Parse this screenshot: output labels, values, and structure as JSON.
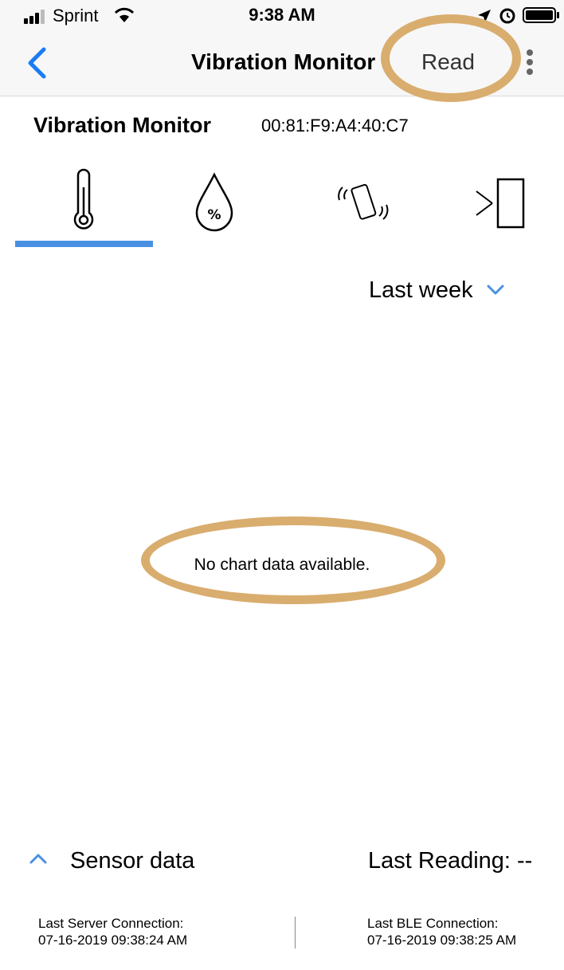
{
  "status_bar": {
    "carrier": "Sprint",
    "time": "9:38 AM"
  },
  "nav": {
    "title": "Vibration Monitor",
    "action_label": "Read",
    "accent_color": "#1a7cf5"
  },
  "device": {
    "name": "Vibration Monitor",
    "mac": "00:81:F9:A4:40:C7"
  },
  "tabs": [
    {
      "icon": "thermometer-icon",
      "selected": true
    },
    {
      "icon": "humidity-drop-icon",
      "selected": false
    },
    {
      "icon": "vibration-icon",
      "selected": false
    },
    {
      "icon": "door-icon",
      "selected": false
    }
  ],
  "range": {
    "selected": "Last week"
  },
  "chart": {
    "empty_message": "No chart data available."
  },
  "sensor": {
    "label": "Sensor data",
    "last_reading": "Last Reading: --"
  },
  "connections": {
    "server_label": "Last Server Connection:",
    "server_time": "07-16-2019 09:38:24 AM",
    "ble_label": "Last BLE Connection:",
    "ble_time": "07-16-2019 09:38:25 AM"
  },
  "annotation_color": "#d9ad6e"
}
